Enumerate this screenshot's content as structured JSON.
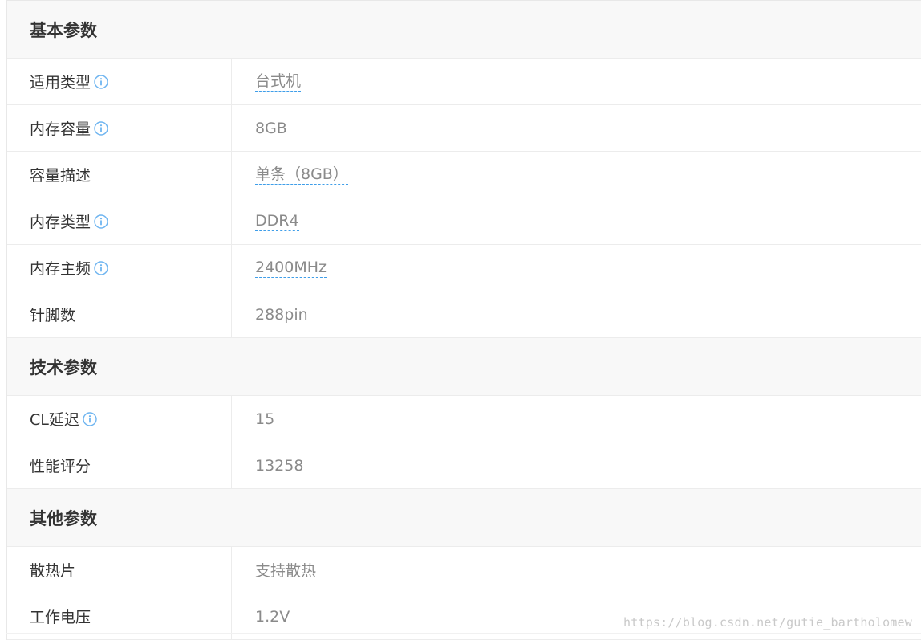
{
  "sections": [
    {
      "title": "基本参数",
      "rows": [
        {
          "label": "适用类型",
          "value": "台式机"
        },
        {
          "label": "内存容量",
          "value": "8GB"
        },
        {
          "label": "容量描述",
          "value": "单条（8GB）"
        },
        {
          "label": "内存类型",
          "value": "DDR4"
        },
        {
          "label": "内存主频",
          "value": "2400MHz"
        },
        {
          "label": "针脚数",
          "value": "288pin"
        }
      ]
    },
    {
      "title": "技术参数",
      "rows": [
        {
          "label": "CL延迟",
          "value": "15"
        },
        {
          "label": "性能评分",
          "value": "13258"
        }
      ]
    },
    {
      "title": "其他参数",
      "rows": [
        {
          "label": "散热片",
          "value": "支持散热"
        },
        {
          "label": "工作电压",
          "value": "1.2V"
        }
      ]
    }
  ],
  "watermark": "https://blog.csdn.net/gutie_bartholomew",
  "colors": {
    "info_icon": "#6db4f0",
    "link_underline": "#3f9ee9",
    "header_bg": "#f8f8f8",
    "border": "#ececec",
    "label_text": "#333333",
    "value_text": "#8a8a8a"
  },
  "icons": {
    "info": "info-circle-icon"
  }
}
